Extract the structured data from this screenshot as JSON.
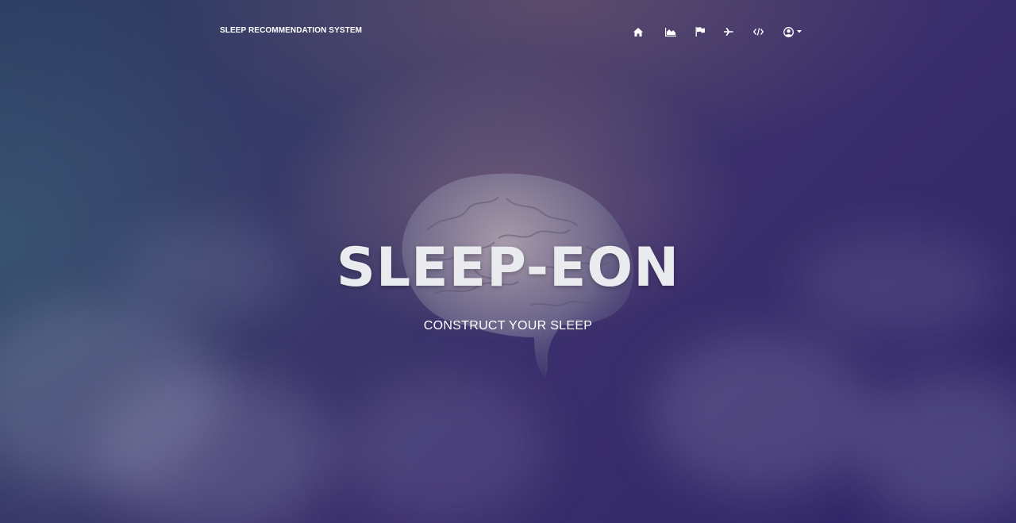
{
  "navbar": {
    "brand": "SLEEP RECOMMENDATION SYSTEM",
    "items": [
      {
        "name": "home-icon"
      },
      {
        "name": "chart-area-icon"
      },
      {
        "name": "flag-icon"
      },
      {
        "name": "plane-icon"
      },
      {
        "name": "code-icon"
      },
      {
        "name": "user-circle-icon"
      }
    ]
  },
  "hero": {
    "title": "SLEEP-EON",
    "subtitle": "CONSTRUCT YOUR SLEEP"
  },
  "colors": {
    "background_top_left": "#2c3d62",
    "background_bottom_right": "#2f2668",
    "text": "#ffffff",
    "title": "#e9ebef"
  }
}
